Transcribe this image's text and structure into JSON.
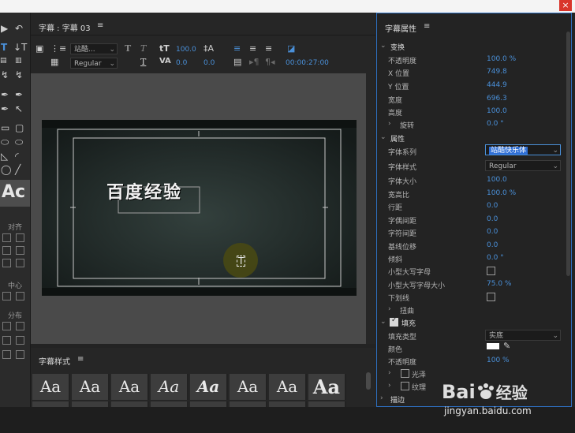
{
  "window": {
    "close_label": "×"
  },
  "tools": {
    "align_label": "对齐",
    "center_label": "中心",
    "distribute_label": "分布"
  },
  "editor": {
    "tab_label": "字幕 : 字幕 03",
    "menu_icon": "≡",
    "font_family_value": "站酷...",
    "font_style_value": "Regular",
    "font_size_value": "100.0",
    "kerning_value": "0.0",
    "leading_value": "0.0",
    "timecode": "00:00:27:00",
    "title_text": "百度经验"
  },
  "styles": {
    "tab_label": "字幕样式",
    "menu_icon": "≡",
    "swatches": [
      "Aa",
      "Aa",
      "Aa",
      "Aa",
      "Aa",
      "Aa",
      "Aa",
      "Aa"
    ]
  },
  "properties": {
    "tab_label": "字幕属性",
    "menu_icon": "≡",
    "transform": {
      "header": "变换",
      "opacity_label": "不透明度",
      "opacity_value": "100.0 %",
      "x_label": "X 位置",
      "x_value": "749.8",
      "y_label": "Y 位置",
      "y_value": "444.9",
      "width_label": "宽度",
      "width_value": "696.3",
      "height_label": "高度",
      "height_value": "100.0",
      "rotation_label": "旋转",
      "rotation_value": "0.0 °"
    },
    "attributes": {
      "header": "属性",
      "font_family_label": "字体系列",
      "font_family_value": "站酷快乐体",
      "font_style_label": "字体样式",
      "font_style_value": "Regular",
      "font_size_label": "字体大小",
      "font_size_value": "100.0",
      "aspect_label": "宽高比",
      "aspect_value": "100.0 %",
      "leading_label": "行距",
      "leading_value": "0.0",
      "kerning_label": "字偶间距",
      "kerning_value": "0.0",
      "tracking_label": "字符间距",
      "tracking_value": "0.0",
      "baseline_label": "基线位移",
      "baseline_value": "0.0",
      "slant_label": "倾斜",
      "slant_value": "0.0 °",
      "smallcaps_label": "小型大写字母",
      "smallcaps_size_label": "小型大写字母大小",
      "smallcaps_size_value": "75.0 %",
      "underline_label": "下划线",
      "distort_label": "扭曲"
    },
    "fill": {
      "header": "填充",
      "type_label": "填充类型",
      "type_value": "实底",
      "color_label": "颜色",
      "opacity_label": "不透明度",
      "opacity_value": "100 %",
      "sheen_label": "光泽",
      "texture_label": "纹理"
    },
    "stroke": {
      "header": "描边"
    }
  },
  "watermark": {
    "brand": "Bai",
    "brand_suffix": "经验",
    "url": "jingyan.baidu.com"
  },
  "colors": {
    "accent": "#4a90d9",
    "selection": "#2e6fc0"
  }
}
